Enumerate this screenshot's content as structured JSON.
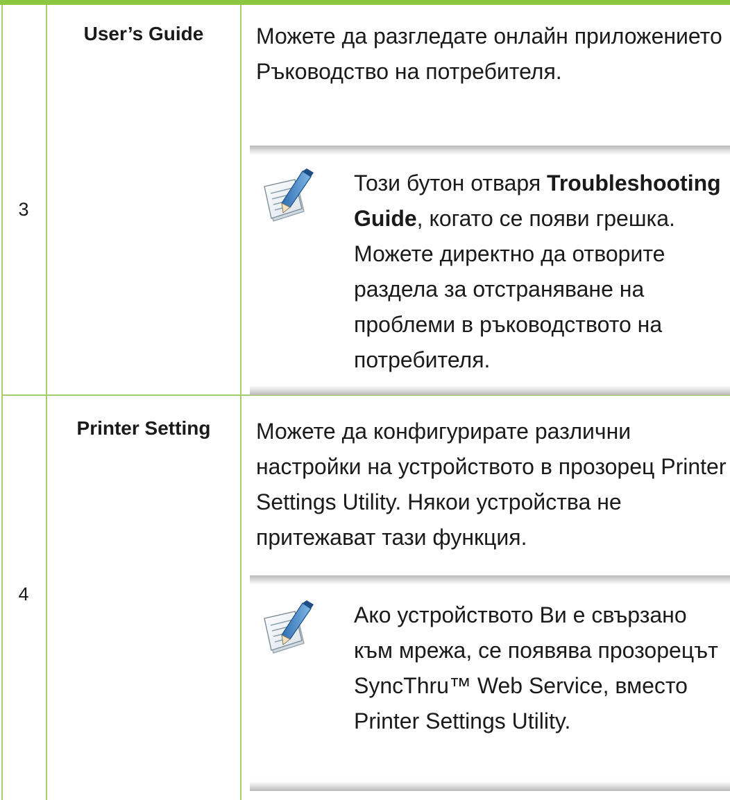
{
  "rows": [
    {
      "number": "3",
      "name": "User’s Guide",
      "description": "Можете да разгледате онлайн приложението Ръководство на потребителя.",
      "note": {
        "icon": "note-pencil-icon",
        "text_before": "Този бутон отваря ",
        "text_bold": "Troubleshooting Guide",
        "text_after": ", когато се появи грешка. Можете директно да отворите раздела за отстраняване на проблеми в ръководството на потребителя."
      }
    },
    {
      "number": "4",
      "name": "Printer Setting",
      "description": "Можете да конфигурирате различни настройки на устройството в прозорец Printer Settings Utility. Някои устройства не притежават тази функция.",
      "note": {
        "icon": "note-pencil-icon",
        "text": "Ако устройството Ви е свързано към мрежа, се появява прозорецът SyncThru™ Web Service, вместо Printer Settings Utility."
      }
    }
  ],
  "colors": {
    "rule": "#8dc63f",
    "grid": "#a2cd6a"
  }
}
